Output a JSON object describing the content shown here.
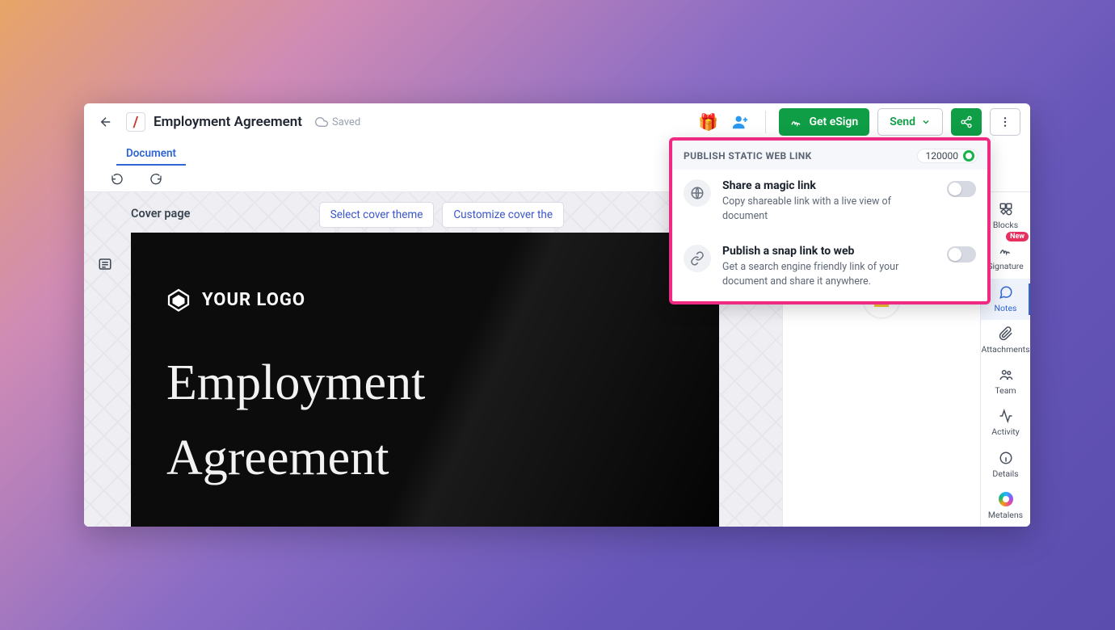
{
  "header": {
    "doc_icon_glyph": "/",
    "title": "Employment Agreement",
    "saved_label": "Saved",
    "get_esign_label": "Get eSign",
    "send_label": "Send"
  },
  "tabs": {
    "document": "Document"
  },
  "cover": {
    "label": "Cover page",
    "select_theme": "Select cover theme",
    "customize": "Customize cover the",
    "logo_text": "YOUR LOGO",
    "headline": "Employment Agreement"
  },
  "rightrail": {
    "blocks": "Blocks",
    "signature": "Signature",
    "signature_badge": "New",
    "notes": "Notes",
    "attachments": "Attachments",
    "team": "Team",
    "activity": "Activity",
    "details": "Details",
    "metalens": "Metalens"
  },
  "popover": {
    "heading": "PUBLISH STATIC WEB LINK",
    "counter": "120000",
    "magic": {
      "title": "Share a magic link",
      "desc": "Copy shareable link with a live view of document"
    },
    "snap": {
      "title": "Publish a snap link to web",
      "desc": "Get a search engine friendly link of your document and share it anywhere."
    }
  }
}
